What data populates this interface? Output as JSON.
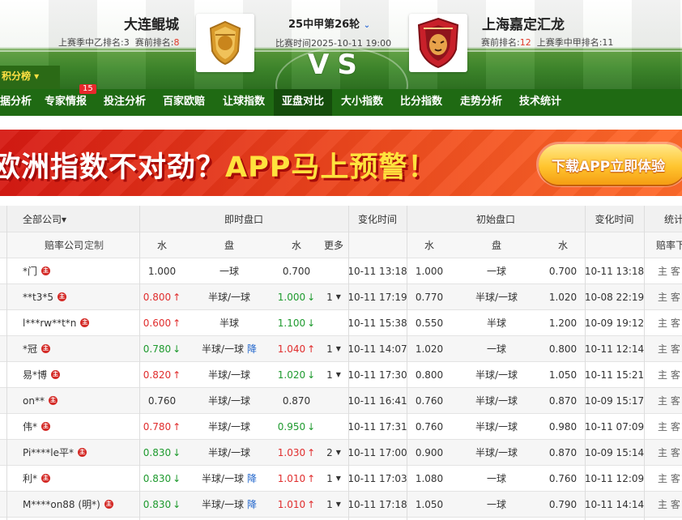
{
  "header": {
    "home": {
      "name": "大连鲲城",
      "last_season_label": "上赛季中乙排名:3",
      "pre_rank_label": "赛前排名:",
      "pre_rank_value": "8"
    },
    "away": {
      "name": "上海嘉定汇龙",
      "pre_rank_label": "赛前排名:",
      "pre_rank_value": "12",
      "last_season_label": "上赛季中甲排名:11"
    },
    "round": "25中甲第26轮",
    "match_time": "比赛时间2025-10-11 19:00",
    "vs": "VS",
    "standings_button": "积分榜 ▾",
    "home_logo": "dalian-kuncheng-crest",
    "away_logo": "shanghai-jiading-tiger-crest"
  },
  "nav": {
    "items": [
      "据分析",
      "专家情报",
      "投注分析",
      "百家欧赔",
      "让球指数",
      "亚盘对比",
      "大小指数",
      "比分指数",
      "走势分析",
      "技术统计"
    ],
    "active_index": 5,
    "badge": "15"
  },
  "banner": {
    "text_part1": "欧洲指数不对劲？",
    "text_part2": "APP马上预警！",
    "button": "下载APP立即体验"
  },
  "table": {
    "header_row1": {
      "company_filter": "全部公司▾",
      "live": "即时盘口",
      "change_time": "变化时间",
      "initial": "初始盘口",
      "change_time2": "变化时间",
      "stats": "统计"
    },
    "header_row2": {
      "company": "赔率公司",
      "custom": "定制",
      "water1": "水",
      "line1": "盘",
      "water2": "水",
      "more": "更多",
      "water3": "水",
      "line2": "盘",
      "water4": "水",
      "stats_sub": "赔率下"
    },
    "main_badge_text": "主",
    "home_away": [
      "主",
      "客"
    ],
    "rows": [
      {
        "company": "*门",
        "w1": "1.000",
        "w1d": "",
        "line": "一球",
        "ld": "",
        "w2": "0.700",
        "w2d": "",
        "more": "",
        "time": "10-11 13:18",
        "iw1": "1.000",
        "iline": "一球",
        "iw2": "0.700",
        "itime": "10-11 13:18"
      },
      {
        "company": "**t3*5",
        "w1": "0.800",
        "w1d": "up",
        "line": "半球/一球",
        "ld": "",
        "w2": "1.000",
        "w2d": "dn",
        "more": "1",
        "time": "10-11 17:19",
        "iw1": "0.770",
        "iline": "半球/一球",
        "iw2": "1.020",
        "itime": "10-08 22:19"
      },
      {
        "company": "l***rw**t*n",
        "w1": "0.600",
        "w1d": "up",
        "line": "半球",
        "ld": "",
        "w2": "1.100",
        "w2d": "dn",
        "more": "",
        "time": "10-11 15:38",
        "iw1": "0.550",
        "iline": "半球",
        "iw2": "1.200",
        "itime": "10-09 19:12"
      },
      {
        "company": "*冠",
        "w1": "0.780",
        "w1d": "dn",
        "line": "半球/一球",
        "ld": "降",
        "w2": "1.040",
        "w2d": "up",
        "more": "1",
        "time": "10-11 14:07",
        "iw1": "1.020",
        "iline": "一球",
        "iw2": "0.800",
        "itime": "10-11 12:14"
      },
      {
        "company": "易*博",
        "w1": "0.820",
        "w1d": "up",
        "line": "半球/一球",
        "ld": "",
        "w2": "1.020",
        "w2d": "dn",
        "more": "1",
        "time": "10-11 17:30",
        "iw1": "0.800",
        "iline": "半球/一球",
        "iw2": "1.050",
        "itime": "10-11 15:21"
      },
      {
        "company": "on**",
        "w1": "0.760",
        "w1d": "",
        "line": "半球/一球",
        "ld": "",
        "w2": "0.870",
        "w2d": "",
        "more": "",
        "time": "10-11 16:41",
        "iw1": "0.760",
        "iline": "半球/一球",
        "iw2": "0.870",
        "itime": "10-09 15:17"
      },
      {
        "company": "伟*",
        "w1": "0.780",
        "w1d": "up",
        "line": "半球/一球",
        "ld": "",
        "w2": "0.950",
        "w2d": "dn",
        "more": "",
        "time": "10-11 17:31",
        "iw1": "0.760",
        "iline": "半球/一球",
        "iw2": "0.980",
        "itime": "10-11 07:09"
      },
      {
        "company": "Pi****le平*",
        "w1": "0.830",
        "w1d": "dn",
        "line": "半球/一球",
        "ld": "",
        "w2": "1.030",
        "w2d": "up",
        "more": "2",
        "time": "10-11 17:00",
        "iw1": "0.900",
        "iline": "半球/一球",
        "iw2": "0.870",
        "itime": "10-09 15:14"
      },
      {
        "company": "利*",
        "w1": "0.830",
        "w1d": "dn",
        "line": "半球/一球",
        "ld": "降",
        "w2": "1.010",
        "w2d": "up",
        "more": "1",
        "time": "10-11 17:03",
        "iw1": "1.080",
        "iline": "一球",
        "iw2": "0.760",
        "itime": "10-11 12:09"
      },
      {
        "company": "M****on88 (明*)",
        "w1": "0.830",
        "w1d": "dn",
        "line": "半球/一球",
        "ld": "降",
        "w2": "1.010",
        "w2d": "up",
        "more": "1",
        "time": "10-11 17:18",
        "iw1": "1.050",
        "iline": "一球",
        "iw2": "0.790",
        "itime": "10-11 14:14"
      }
    ]
  },
  "colors": {
    "up": "#e02d2d",
    "down": "#1e9a2e",
    "nav": "#1f6a13",
    "banner": "#e63a1c"
  }
}
